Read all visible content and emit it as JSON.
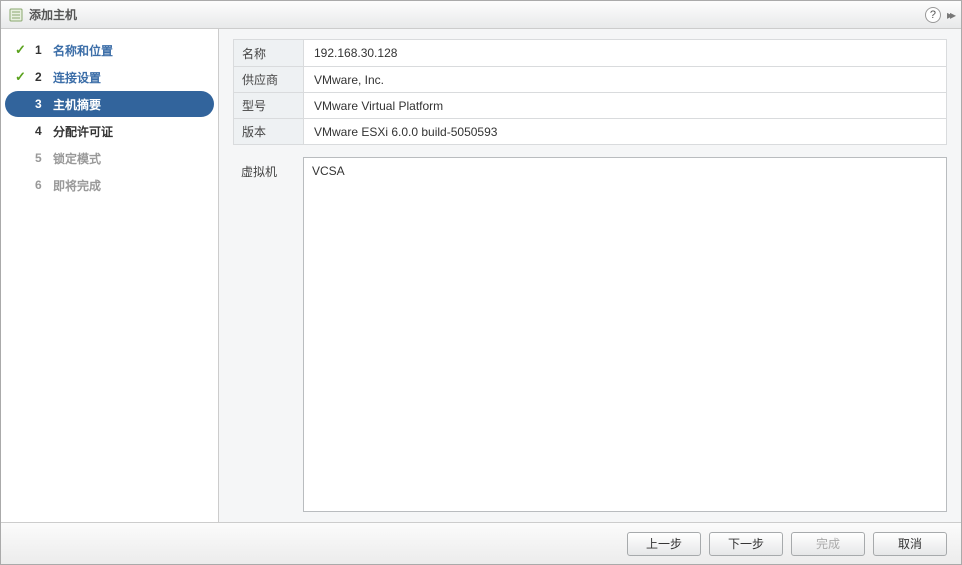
{
  "header": {
    "title": "添加主机"
  },
  "steps": [
    {
      "num": "1",
      "label": "名称和位置",
      "state": "completed"
    },
    {
      "num": "2",
      "label": "连接设置",
      "state": "completed"
    },
    {
      "num": "3",
      "label": "主机摘要",
      "state": "current"
    },
    {
      "num": "4",
      "label": "分配许可证",
      "state": "pending"
    },
    {
      "num": "5",
      "label": "锁定模式",
      "state": "disabled"
    },
    {
      "num": "6",
      "label": "即将完成",
      "state": "disabled"
    }
  ],
  "summary": {
    "name_label": "名称",
    "name_value": "192.168.30.128",
    "vendor_label": "供应商",
    "vendor_value": "VMware, Inc.",
    "model_label": "型号",
    "model_value": "VMware Virtual Platform",
    "version_label": "版本",
    "version_value": "VMware ESXi 6.0.0 build-5050593",
    "vm_label": "虚拟机",
    "vm_list": "VCSA"
  },
  "footer": {
    "back": "上一步",
    "next": "下一步",
    "finish": "完成",
    "cancel": "取消"
  }
}
